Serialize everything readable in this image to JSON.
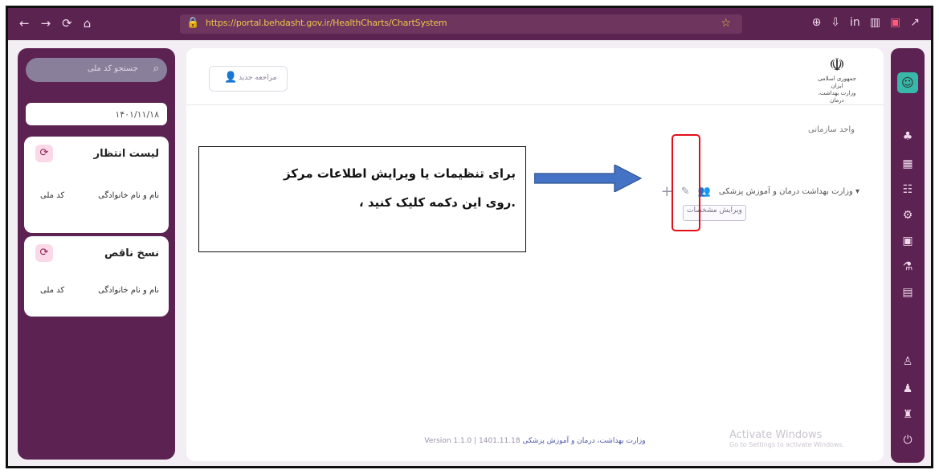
{
  "browser": {
    "url": "https://portal.behdasht.gov.ir/HealthCharts/ChartSystem",
    "nav_icons": [
      "←",
      "→",
      "⟳",
      "⌂"
    ],
    "ext_icons": [
      "⊕",
      "⇩",
      "in",
      "▥",
      "▣",
      "↗"
    ]
  },
  "leftpanel": {
    "search_placeholder": "جستجو کد ملی",
    "date": "۱۴۰۱/۱۱/۱۸",
    "waiting": {
      "title": "لیست انتظار",
      "col_name": "نام و نام خانوادگی",
      "col_code": "کد ملی"
    },
    "incomplete": {
      "title": "نسخ ناقص",
      "col_name": "نام و نام خانوادگی",
      "col_code": "کد ملی"
    }
  },
  "main": {
    "user_label": "مراجعه جدید",
    "emblem_text_1": "جمهوری اسلامی ایران",
    "emblem_text_2": "وزارت بهداشت، درمان",
    "breadcrumb": "واحد سازمانی",
    "tree_text": "▾ وزارت بهداشت درمان و آموزش پزشکی",
    "edit_tag": "ویرایش مشخصات",
    "footer_link": "وزارت بهداشت، درمان و آموزش پزشکی",
    "footer_version": "Version 1.1.0 | 1401.11.18",
    "watermark_1": "Activate Windows",
    "watermark_2": "Go to Settings to activate Windows."
  },
  "annotation": {
    "line1": "برای تنظیمات یا ویرایش اطلاعات مرکز",
    "line2": "، روی این دکمه کلیک کنید."
  },
  "colors": {
    "panel": "#5c2252",
    "browser": "#5a2350",
    "highlight": "#e30d17",
    "arrow_fill": "#4472c4"
  }
}
